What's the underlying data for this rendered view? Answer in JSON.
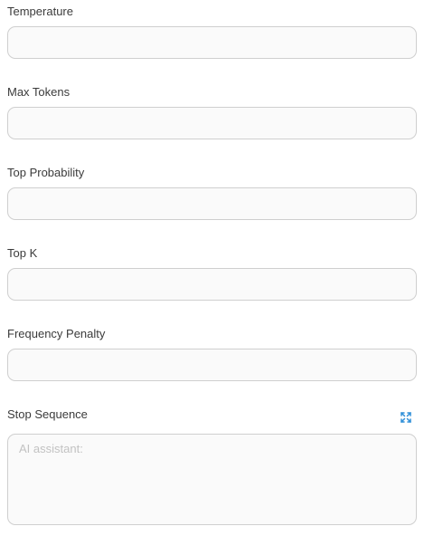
{
  "fields": [
    {
      "label": "Temperature",
      "value": ""
    },
    {
      "label": "Max Tokens",
      "value": ""
    },
    {
      "label": "Top Probability",
      "value": ""
    },
    {
      "label": "Top K",
      "value": ""
    },
    {
      "label": "Frequency Penalty",
      "value": ""
    }
  ],
  "stop_sequence": {
    "label": "Stop Sequence",
    "placeholder": "AI assistant:",
    "value": "",
    "expand_icon": "expand-icon"
  },
  "colors": {
    "border": "#cfcfcf",
    "input_bg": "#fafafa",
    "label": "#3b3b3b",
    "placeholder": "#c2c2c2",
    "icon_accent": "#2f8fd8"
  }
}
